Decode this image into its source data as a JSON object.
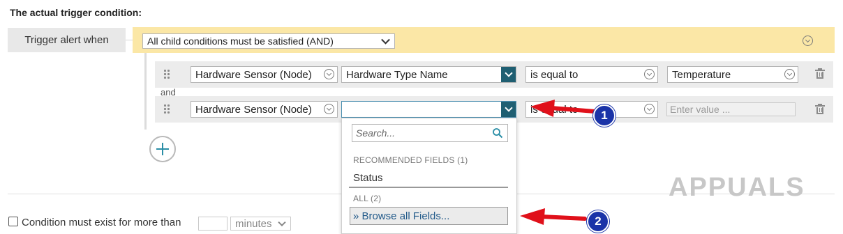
{
  "section_title": "The actual trigger condition:",
  "trigger": {
    "label": "Trigger alert when",
    "mode": "All child conditions must be satisfied (AND)"
  },
  "conditions": [
    {
      "entity": "Hardware Sensor (Node)",
      "field": "Hardware Type Name",
      "operator": "is equal to",
      "value": "Temperature"
    },
    {
      "entity": "Hardware Sensor (Node)",
      "field": "",
      "operator": "is equal to",
      "value_placeholder": "Enter value ..."
    }
  ],
  "and_label": "and",
  "dropdown": {
    "search_placeholder": "Search...",
    "recommended_heading": "RECOMMENDED FIELDS (1)",
    "recommended_items": [
      "Status"
    ],
    "all_heading": "ALL (2)",
    "browse_label": "» Browse all Fields..."
  },
  "duration": {
    "label": "Condition must exist for more than",
    "minutes_value": "",
    "unit": "minutes"
  },
  "annotations": {
    "badge_1": "1",
    "badge_2": "2",
    "arrow_color": "#e0101a",
    "badge_color": "#1a33a8"
  },
  "watermark": "APPUALS",
  "colors": {
    "and_bar": "#fbe7a6",
    "field_button": "#1f5f72",
    "row_background": "#ececec",
    "link": "#225a8a"
  },
  "icons": {
    "circle_chevron": "chevron-down-circle-icon",
    "trash": "trash-icon",
    "grip": "drag-handle-icon",
    "add": "plus-circle-icon",
    "search": "search-icon"
  }
}
